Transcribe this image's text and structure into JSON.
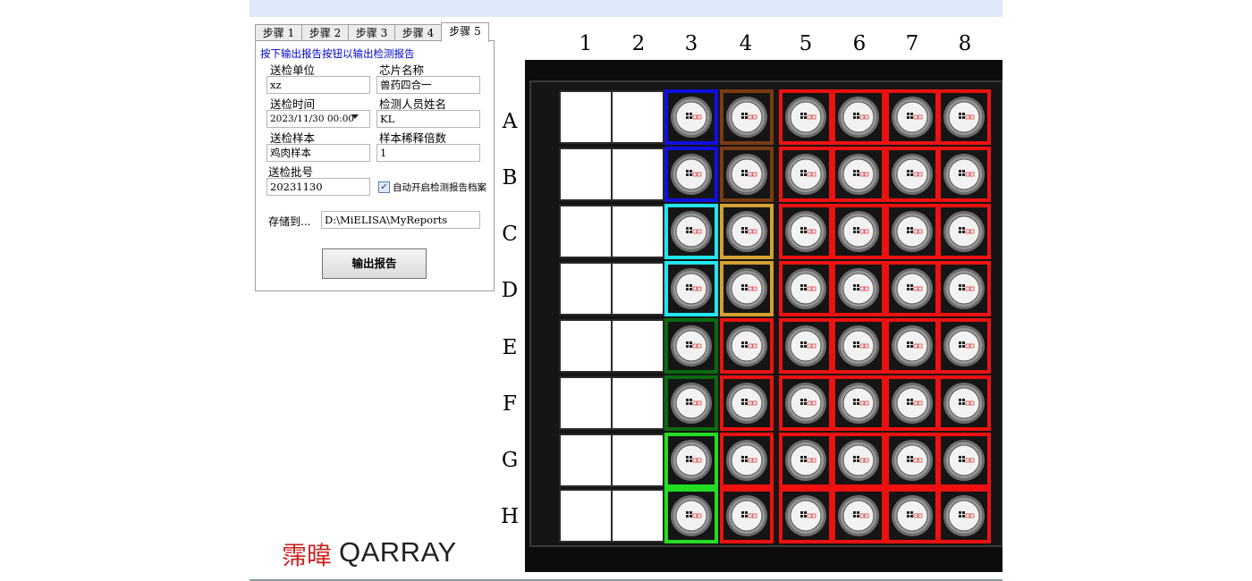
{
  "tabs": [
    {
      "label": "步骤 1",
      "active": false
    },
    {
      "label": "步骤 2",
      "active": false
    },
    {
      "label": "步骤 3",
      "active": false
    },
    {
      "label": "步骤 4",
      "active": false
    },
    {
      "label": "步骤 5",
      "active": true
    }
  ],
  "form": {
    "instruction": "按下输出报告按钮以输出检测报告",
    "sender_unit_label": "送检单位",
    "sender_unit_value": "xz",
    "chip_name_label": "芯片名称",
    "chip_name_value": "兽药四合一",
    "send_time_label": "送检时间",
    "send_time_value": "2023/11/30 00:00",
    "inspector_label": "检测人员姓名",
    "inspector_value": "KL",
    "sample_label": "送检样本",
    "sample_value": "鸡肉样本",
    "dilution_label": "样本稀释倍数",
    "dilution_value": "1",
    "batch_label": "送检批号",
    "batch_value": "20231130",
    "auto_open_label": "自动开启检测报告档案",
    "auto_open_checked": true,
    "save_to_label": "存储到...",
    "save_path": "D:\\MiELISA\\MyReports",
    "export_button": "输出报告"
  },
  "logo": {
    "mark_text": "霈暐",
    "word_text": "QARRAY"
  },
  "plate": {
    "columns": [
      "1",
      "2",
      "3",
      "4",
      "5",
      "6",
      "7",
      "8"
    ],
    "rows": [
      "A",
      "B",
      "C",
      "D",
      "E",
      "F",
      "G",
      "H"
    ],
    "colors": {
      "blue": "#1010e0",
      "brown": "#7a3b12",
      "cyan": "#22e4f2",
      "gold": "#d4a030",
      "dark_green": "#0a6a10",
      "green": "#22dd22",
      "red": "#ee1111"
    },
    "column_highlights": {
      "3": [
        "blue",
        "blue",
        "cyan",
        "cyan",
        "dark_green",
        "dark_green",
        "green",
        "green"
      ],
      "4": [
        "brown",
        "brown",
        "gold",
        "gold",
        "red",
        "red",
        "red",
        "red"
      ],
      "5": [
        "red",
        "red",
        "red",
        "red",
        "red",
        "red",
        "red",
        "red"
      ],
      "6": [
        "red",
        "red",
        "red",
        "red",
        "red",
        "red",
        "red",
        "red"
      ],
      "7": [
        "red",
        "red",
        "red",
        "red",
        "red",
        "red",
        "red",
        "red"
      ],
      "8": [
        "red",
        "red",
        "red",
        "red",
        "red",
        "red",
        "red",
        "red"
      ]
    },
    "empty_columns": [
      "1",
      "2"
    ]
  }
}
